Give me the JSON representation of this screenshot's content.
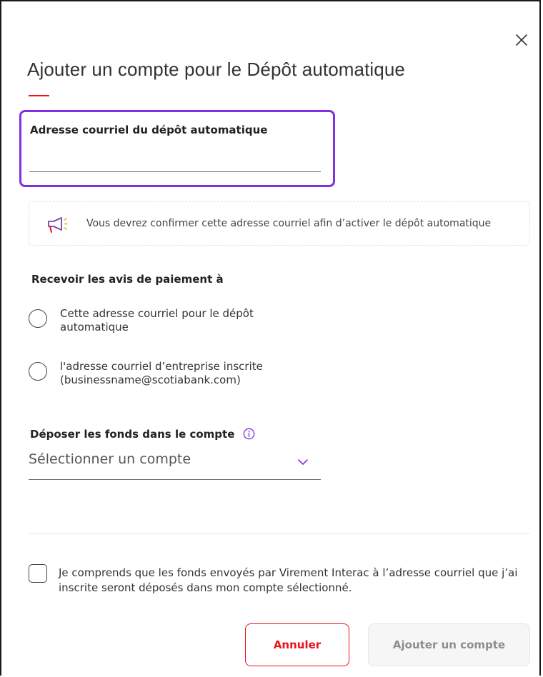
{
  "dialog": {
    "title": "Ajouter un compte pour le Dépôt automatique",
    "close_icon": "close-icon"
  },
  "email_field": {
    "label": "Adresse courriel du dépôt automatique",
    "value": "",
    "placeholder": ""
  },
  "notice": {
    "icon": "megaphone-icon",
    "text": "Vous devrez confirmer cette adresse courriel afin d’activer le dépôt automatique"
  },
  "notifications": {
    "heading": "Recevoir les avis de paiement à",
    "options": [
      {
        "label": "Cette adresse courriel pour le dépôt automatique",
        "selected": false
      },
      {
        "label": "l'adresse courriel d’entreprise inscrite (businessname@scotiabank.com)",
        "selected": false
      }
    ]
  },
  "deposit_account": {
    "heading": "Déposer les fonds dans le compte",
    "info_icon": "info-icon",
    "selected_value": "Sélectionner un compte",
    "chevron_icon": "chevron-down-icon"
  },
  "consent": {
    "checked": false,
    "text": "Je comprends que les fonds envoyés par Virement Interac à l’adresse courriel que j’ai inscrite seront déposés dans mon compte sélectionné."
  },
  "actions": {
    "cancel_label": "Annuler",
    "add_label": "Ajouter un compte",
    "add_enabled": false
  },
  "colors": {
    "brand_red": "#ec111a",
    "focus_purple": "#8230df",
    "text": "#333333"
  }
}
